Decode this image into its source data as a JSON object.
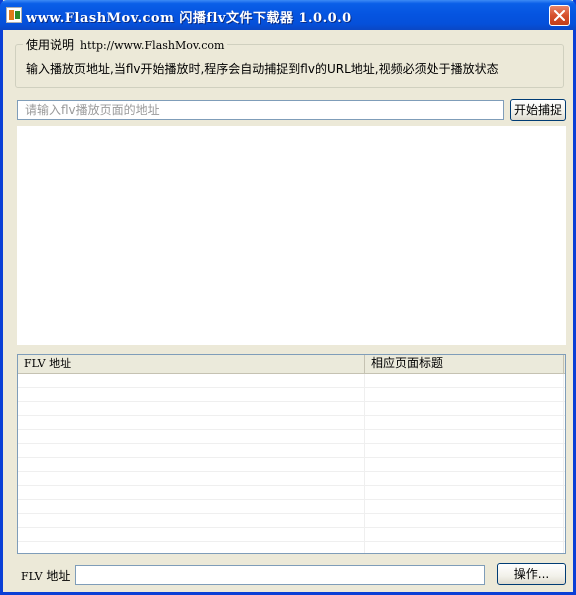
{
  "window": {
    "title": "www.FlashMov.com 闪播flv文件下载器 1.0.0.0"
  },
  "instructions": {
    "legend": "使用说明",
    "url": "http://www.FlashMov.com",
    "description": "输入播放页地址,当flv开始播放时,程序会自动捕捉到flv的URL地址,视频必须处于播放状态"
  },
  "url_bar": {
    "value": "",
    "placeholder": "请输入flv播放页面的地址",
    "capture_button": "开始捕捉"
  },
  "list": {
    "columns": [
      "FLV 地址",
      "相应页面标题"
    ],
    "rows": []
  },
  "footer": {
    "flv_label_prefix": "FLV",
    "flv_label_suffix": " 地址",
    "flv_value": "",
    "action_button": "操作..."
  },
  "icons": {
    "app": "app-icon",
    "close": "close-icon"
  },
  "colors": {
    "titlebar": "#0554E0",
    "window_bg": "#ECE9D8",
    "close": "#D6502C"
  }
}
